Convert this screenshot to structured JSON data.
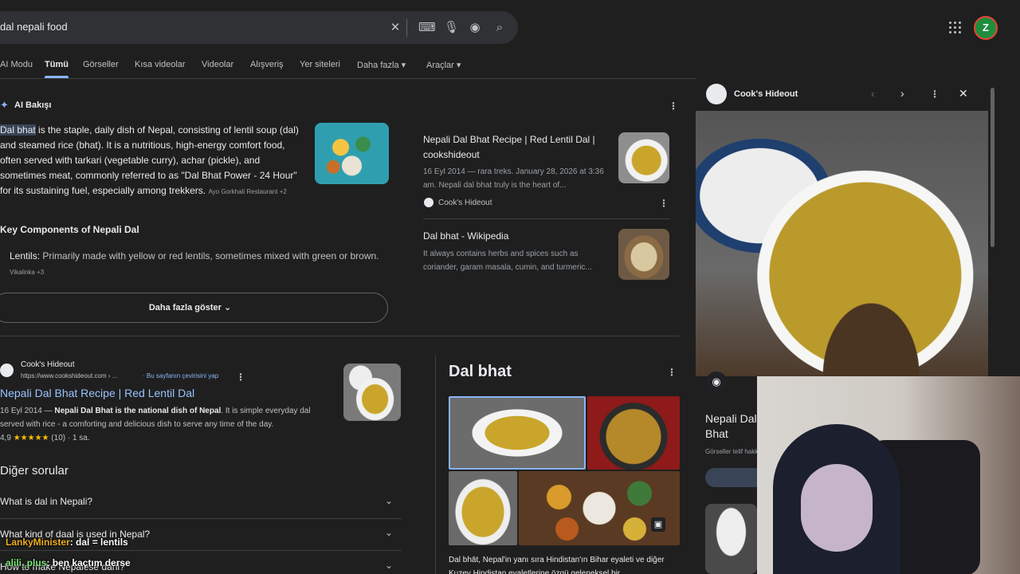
{
  "search": {
    "query": "dal nepali food"
  },
  "tabs": [
    "AI Modu",
    "Tümü",
    "Görseller",
    "Kısa videolar",
    "Videolar",
    "Alışveriş",
    "Yer siteleri",
    "Daha fazla",
    "Araçlar"
  ],
  "account": {
    "initial": "Z"
  },
  "ai_overview": {
    "title": "AI Bakışı",
    "highlight": "Dal bhat",
    "text": " is the staple, daily dish of Nepal, consisting of lentil soup (dal) and steamed rice (bhat). It is a nutritious, high-energy comfort food, often served with tarkari (vegetable curry), achar (pickle), and sometimes meat, commonly referred to as \"Dal Bhat Power - 24 Hour\" for its sustaining fuel, especially among trekkers.",
    "source_chip": "Ayo Gorkhali Restaurant +2",
    "key_components_title": "Key Components of Nepali Dal",
    "lentils_label": "Lentils:",
    "lentils_text": " Primarily made with yellow or red lentils, sometimes mixed with green or brown.",
    "lentils_chip": "Vikalinka +3",
    "show_more": "Daha fazla göster"
  },
  "aio_cards": [
    {
      "title": "Nepali Dal Bhat Recipe | Red Lentil Dal | cookshideout",
      "snippet": "16 Eyl 2014 — rara treks. January 28, 2026 at 3:36 am. Nepali dal bhat truly is the heart of...",
      "source": "Cook's Hideout"
    },
    {
      "title": "Dal bhat - Wikipedia",
      "snippet": "It always contains herbs and spices such as coriander, garam masala, cumin, and turmeric..."
    }
  ],
  "result": {
    "site": "Cook's Hideout",
    "url": "https://www.cookshideout.com › ...",
    "translate": "Bu sayfanın çevirisini yap",
    "title": "Nepali Dal Bhat Recipe | Red Lentil Dal",
    "date": "16 Eyl 2014 — ",
    "bold_snip": "Nepali Dal Bhat is the national dish of Nepal",
    "snip": ". It is simple everyday dal served with rice - a comforting and delicious dish to serve any time of the day.",
    "rating": "4,9",
    "stars": "★★★★★",
    "reviews": "(10) · 1 sa."
  },
  "paa": {
    "title": "Diğer sorular",
    "questions": [
      "What is dal in Nepali?",
      "What kind of daal is used in Nepal?",
      "How to make Nepalese dahl?"
    ]
  },
  "knowledge_panel": {
    "title": "Dal bhat",
    "desc": "Dal bhāt, Nepal'in yanı sıra Hindistan'ın Bihar eyaleti ve diğer Kuzey Hindistan eyaletlerine özgü geleneksel bir"
  },
  "preview": {
    "source": "Cook's Hideout",
    "title": "Nepali Dal Bhat Recipe | Red Lentil Dal | cookshideout",
    "subtitle": "Görseller telif hakkına tabi olabilir."
  },
  "chat": [
    {
      "user": "LankyMinister",
      "user_color": "#f0b020",
      "message": ": dal = lentils"
    },
    {
      "user": "alili_plus",
      "user_color": "#7de87d",
      "message": ": ben kaçtım derse"
    }
  ]
}
